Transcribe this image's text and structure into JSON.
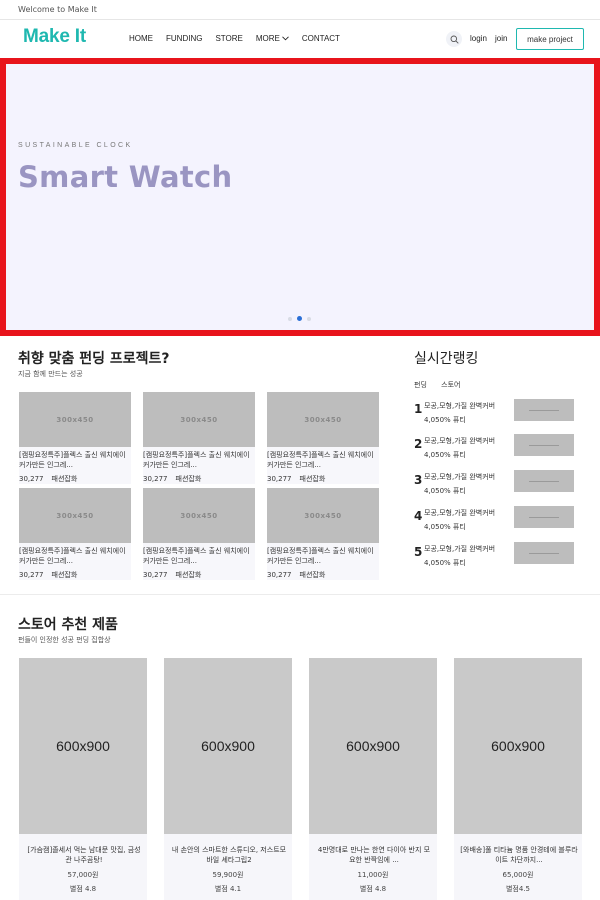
{
  "topbar": {
    "welcome": "Welcome to Make It"
  },
  "nav": {
    "logo": "Make It",
    "menu": [
      "HOME",
      "FUNDING",
      "STORE",
      "MORE",
      "CONTACT"
    ],
    "login": "login",
    "join": "join",
    "make_project": "make project"
  },
  "hero": {
    "eyebrow": "SUSTAINABLE CLOCK",
    "title": "Smart Watch",
    "slides": 3,
    "active_slide": 2
  },
  "funding": {
    "title": "취향 맞춤 펀딩 프로젝트?",
    "subtitle": "지금 함께 만드는 성공",
    "placeholder": "300x450",
    "cards": [
      {
        "title": "[캠핑요정특주]플렉스 출신 웨치에이커가만든 인그레...",
        "count": "30,277",
        "category": "패션잡화"
      },
      {
        "title": "[캠핑요정특주]플렉스 출신 웨치에이커가만든 인그레...",
        "count": "30,277",
        "category": "패션잡화"
      },
      {
        "title": "[캠핑요정특주]플렉스 출신 웨치에이커가만든 인그레...",
        "count": "30,277",
        "category": "패션잡화"
      },
      {
        "title": "[캠핑요정특주]플렉스 출신 웨치에이커가만든 인그레...",
        "count": "30,277",
        "category": "패션잡화"
      },
      {
        "title": "[캠핑요정특주]플렉스 출신 웨치에이커가만든 인그레...",
        "count": "30,277",
        "category": "패션잡화"
      },
      {
        "title": "[캠핑요정특주]플렉스 출신 웨치에이커가만든 인그레...",
        "count": "30,277",
        "category": "패션잡화"
      }
    ]
  },
  "ranking": {
    "title": "실시간랭킹",
    "tabs": [
      "펀딩",
      "스토어"
    ],
    "items": [
      {
        "rank": "1",
        "name": "모공,모형,가질 완벽커버",
        "rate": "4,050% 퓨티"
      },
      {
        "rank": "2",
        "name": "모공,모형,가질 완벽커버",
        "rate": "4,050% 퓨티"
      },
      {
        "rank": "3",
        "name": "모공,모형,가질 완벽커버",
        "rate": "4,050% 퓨티"
      },
      {
        "rank": "4",
        "name": "모공,모형,가질 완벽커버",
        "rate": "4,050% 퓨티"
      },
      {
        "rank": "5",
        "name": "모공,모형,가질 완벽커버",
        "rate": "4,050% 퓨티"
      }
    ]
  },
  "store": {
    "title": "스토어 추천 제품",
    "subtitle": "펀들이 인정한 성공 펀딩 집합상",
    "placeholder": "600x900",
    "products": [
      {
        "title": "[가슴캠]졸세서 먹는 남대문 맛집, 금성관 나주곰탕!",
        "price": "57,000원",
        "rating": "별점 4.8"
      },
      {
        "title": "내 손안의 스마트한 스튜디오, 저스트모바일 셰타그립2",
        "price": "59,900원",
        "rating": "별점 4.1"
      },
      {
        "title": "4만명대로 만나는 한연 다이아 반지 모요한 반짝임에 ...",
        "price": "11,000원",
        "rating": "별점 4.8"
      },
      {
        "title": "[와배송]풀 티타늄 명품 안경테에 블루라이트 차단까지...",
        "price": "65,000원",
        "rating": "별점4.5"
      }
    ]
  },
  "colors": {
    "brand": "#1fb8b0",
    "hero_bg": "#f4f3fe",
    "hero_title": "#9a95c2",
    "highlight_border": "#e8141c",
    "dot_active": "#2b6fd6"
  },
  "icons": [
    "search-icon",
    "chevron-down-icon"
  ]
}
